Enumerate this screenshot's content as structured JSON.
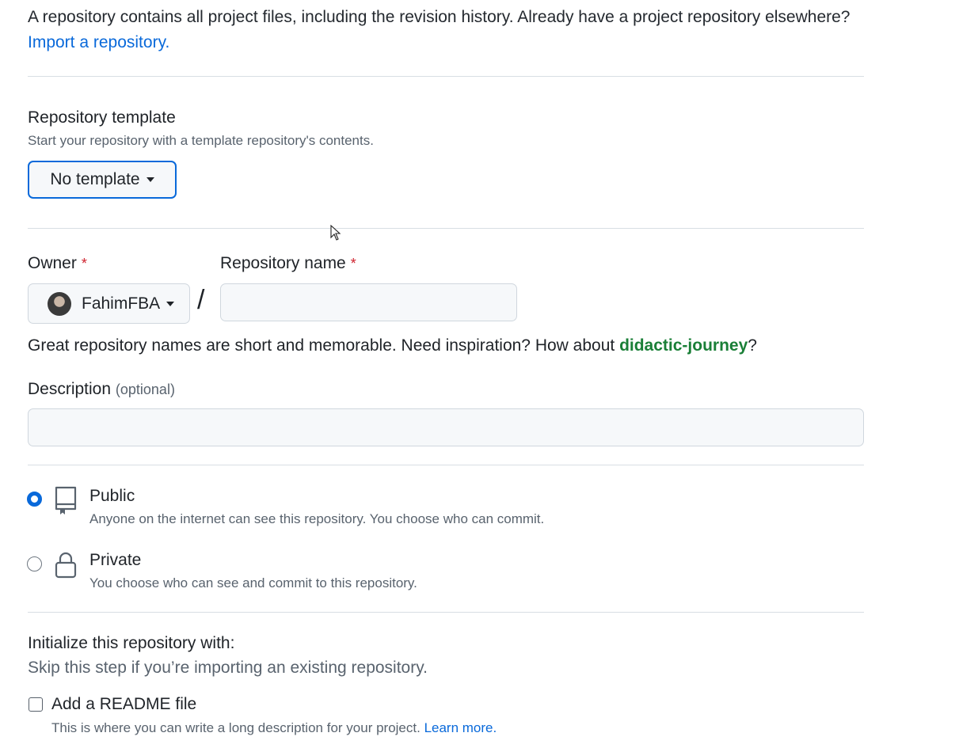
{
  "intro": {
    "text": "A repository contains all project files, including the revision history. Already have a project repository elsewhere?",
    "import_link": "Import a repository."
  },
  "template": {
    "label": "Repository template",
    "help": "Start your repository with a template repository's contents.",
    "button_label": "No template"
  },
  "owner": {
    "label": "Owner",
    "required_mark": "*",
    "value": "FahimFBA"
  },
  "separator": "/",
  "repo_name": {
    "label": "Repository name",
    "required_mark": "*",
    "value": ""
  },
  "name_hint": {
    "prefix": "Great repository names are short and memorable. Need inspiration? How about ",
    "suggestion": "didactic-journey",
    "suffix": "?"
  },
  "description": {
    "label": "Description",
    "optional": "(optional)",
    "value": ""
  },
  "visibility": {
    "selected": "public",
    "options": [
      {
        "id": "public",
        "title": "Public",
        "help": "Anyone on the internet can see this repository. You choose who can commit.",
        "icon": "repo-icon"
      },
      {
        "id": "private",
        "title": "Private",
        "help": "You choose who can see and commit to this repository.",
        "icon": "lock-icon"
      }
    ]
  },
  "init": {
    "title": "Initialize this repository with:",
    "help": "Skip this step if you’re importing an existing repository.",
    "readme_label": "Add a README file",
    "readme_checked": false,
    "readme_help": "This is where you can write a long description for your project.",
    "learn_more": "Learn more."
  },
  "colors": {
    "accent": "#0969da",
    "required": "#cf222e",
    "suggestion": "#1a7f37",
    "border": "#d0d7de"
  }
}
